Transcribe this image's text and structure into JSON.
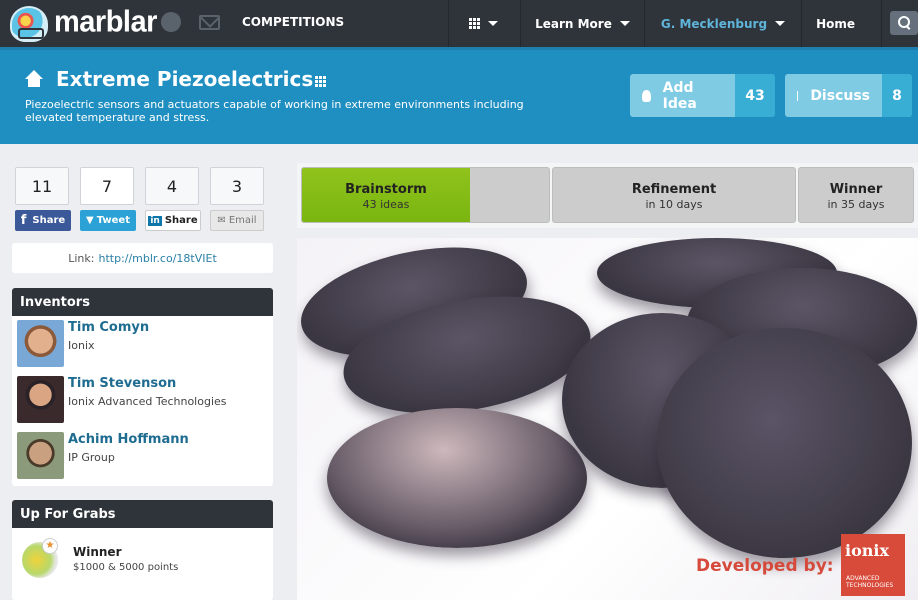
{
  "topbar": {
    "brand": "marblar",
    "icons": [
      "globe-icon",
      "mail-icon"
    ],
    "competitions_label": "COMPETITIONS",
    "apps_icon": "grid-icon",
    "learn_more_label": "Learn More",
    "user_label": "G. Mecklenburg",
    "home_label": "Home",
    "search_icon": "search-icon",
    "user_color": "#5fb5d9"
  },
  "banner": {
    "title": "Extreme Piezoelectrics",
    "description": "Piezoelectric sensors and actuators capable of working in extreme environments including elevated temperature and stress.",
    "add_idea": {
      "label": "Add Idea",
      "count": "43"
    },
    "discuss": {
      "label": "Discuss",
      "count": "8"
    }
  },
  "social": {
    "facebook": {
      "count": "11",
      "label": "Share"
    },
    "twitter": {
      "count": "7",
      "label": "Tweet"
    },
    "linkedin": {
      "count": "4",
      "label": "Share"
    },
    "email": {
      "count": "3",
      "label": "Email"
    },
    "link_prefix": "Link:",
    "link_url": "http://mblr.co/18tVIEt"
  },
  "inventors": {
    "title": "Inventors",
    "people": [
      {
        "name": "Tim Comyn",
        "org": "Ionix"
      },
      {
        "name": "Tim Stevenson",
        "org": "Ionix Advanced Technologies"
      },
      {
        "name": "Achim Hoffmann",
        "org": "IP Group"
      }
    ]
  },
  "grabs": {
    "title": "Up For Grabs",
    "items": [
      {
        "title": "Winner",
        "prize": "$1000 & 5000 points"
      }
    ]
  },
  "stages": [
    {
      "title": "Brainstorm",
      "sub": "43 ideas",
      "progress": 0.68,
      "active": true
    },
    {
      "title": "Refinement",
      "sub": "in 10 days"
    },
    {
      "title": "Winner",
      "sub": "in 35 days"
    }
  ],
  "hero": {
    "developed_by": "Developed by:",
    "company": "ionix",
    "company_sub": "ADVANCED TECHNOLOGIES",
    "accent": "#d84a3a"
  }
}
